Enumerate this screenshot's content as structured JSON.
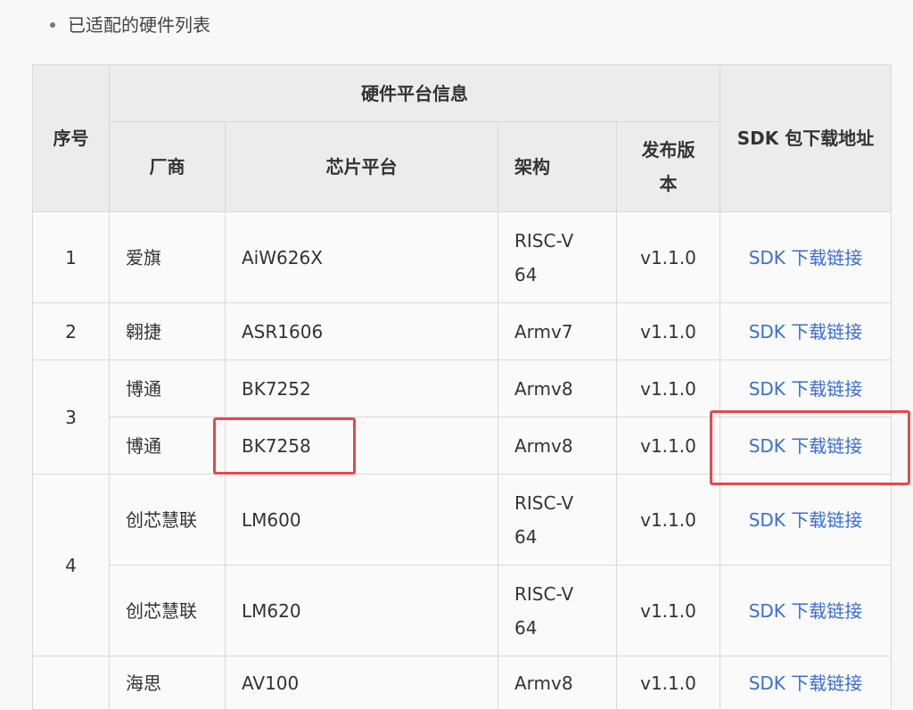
{
  "intro": {
    "text": "已适配的硬件列表"
  },
  "header": {
    "seq": "序号",
    "group": "硬件平台信息",
    "vendor": "厂商",
    "chip": "芯片平台",
    "arch": "架构",
    "version": "发布版本",
    "sdk": "SDK 包下载地址"
  },
  "rows": [
    {
      "seq": "1",
      "vendor": "爱旗",
      "chip": "AiW626X",
      "arch": "RISC-V 64",
      "version": "v1.1.0",
      "sdk": "SDK 下载链接"
    },
    {
      "seq": "2",
      "vendor": "翱捷",
      "chip": "ASR1606",
      "arch": "Armv7",
      "version": "v1.1.0",
      "sdk": "SDK 下载链接"
    },
    {
      "seq": "3",
      "vendor": "博通",
      "chip": "BK7252",
      "arch": "Armv8",
      "version": "v1.1.0",
      "sdk": "SDK 下载链接"
    },
    {
      "vendor": "博通",
      "chip": "BK7258",
      "arch": "Armv8",
      "version": "v1.1.0",
      "sdk": "SDK 下载链接"
    },
    {
      "seq": "4",
      "vendor": "创芯慧联",
      "chip": "LM600",
      "arch": "RISC-V 64",
      "version": "v1.1.0",
      "sdk": "SDK 下载链接"
    },
    {
      "vendor": "创芯慧联",
      "chip": "LM620",
      "arch": "RISC-V 64",
      "version": "v1.1.0",
      "sdk": "SDK 下载链接"
    },
    {
      "vendor": "海思",
      "chip": "AV100",
      "arch": "Armv8",
      "version": "v1.1.0",
      "sdk": "SDK 下载链接"
    }
  ],
  "highlight_color": "#e8474b",
  "link_color": "#3a6fd0"
}
